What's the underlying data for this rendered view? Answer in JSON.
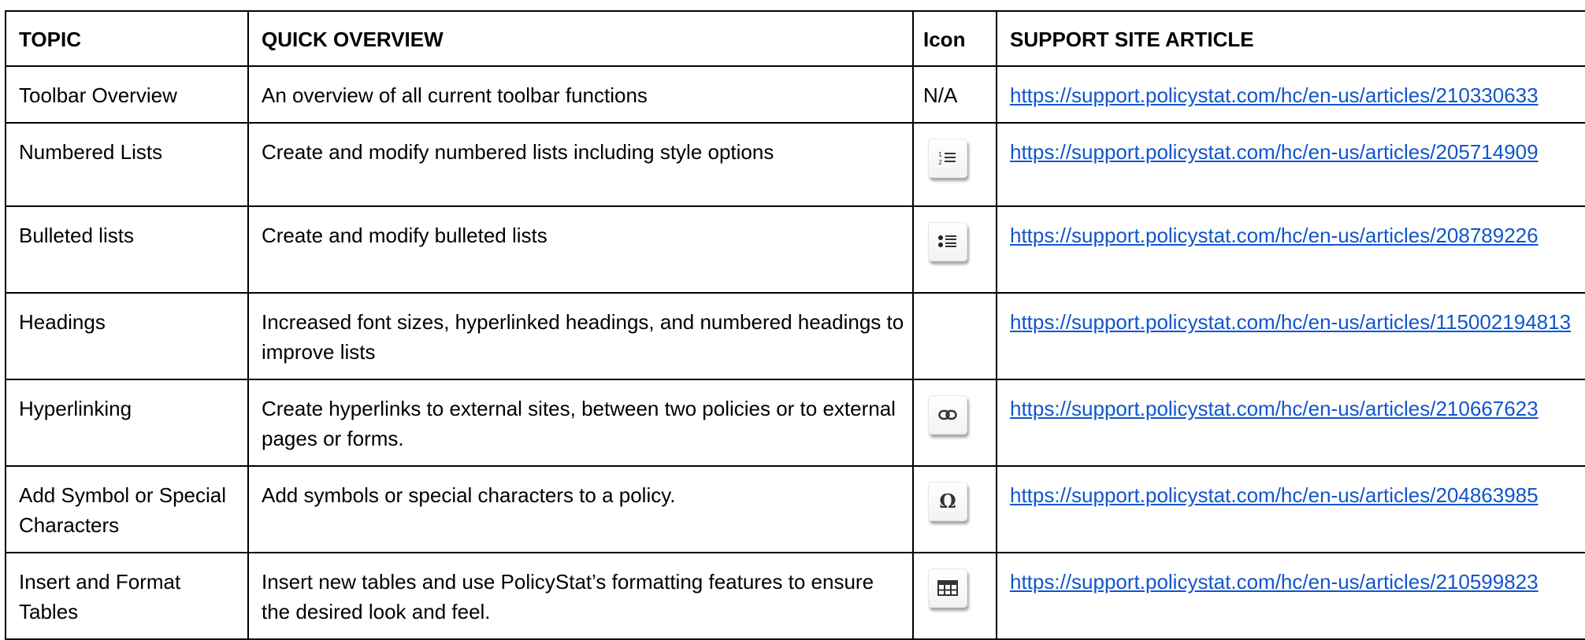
{
  "columns": {
    "topic": "TOPIC",
    "overview": "QUICK OVERVIEW",
    "icon": "Icon",
    "article": "SUPPORT SITE ARTICLE"
  },
  "rows": [
    {
      "topic": "Toolbar Overview",
      "overview": "An overview of all current toolbar functions",
      "icon_text": "N/A",
      "icon": "",
      "article": "https://support.policystat.com/hc/en-us/articles/210330633"
    },
    {
      "topic": "Numbered Lists",
      "overview": "Create and modify numbered lists including style options",
      "icon_text": "",
      "icon": "numbered-list-icon",
      "article": "https://support.policystat.com/hc/en-us/articles/205714909"
    },
    {
      "topic": "Bulleted lists",
      "overview": "Create and modify bulleted lists",
      "icon_text": "",
      "icon": "bulleted-list-icon",
      "article": "https://support.policystat.com/hc/en-us/articles/208789226"
    },
    {
      "topic": "Headings",
      "overview": "Increased font sizes, hyperlinked headings, and numbered headings to improve lists",
      "icon_text": "",
      "icon": "",
      "article": "https://support.policystat.com/hc/en-us/articles/115002194813"
    },
    {
      "topic": "Hyperlinking",
      "overview": "Create hyperlinks to external sites, between two policies or to external pages or forms.",
      "icon_text": "",
      "icon": "link-icon",
      "article": "https://support.policystat.com/hc/en-us/articles/210667623"
    },
    {
      "topic": "Add Symbol or Special Characters",
      "overview": "Add symbols or special characters to a policy.",
      "icon_text": "",
      "icon": "omega-symbol-icon",
      "article": "https://support.policystat.com/hc/en-us/articles/204863985"
    },
    {
      "topic": "Insert and Format Tables",
      "overview": "Insert new tables and use PolicyStat’s formatting features to ensure the desired look and feel.",
      "icon_text": "",
      "icon": "table-icon",
      "article": "https://support.policystat.com/hc/en-us/articles/210599823"
    }
  ],
  "colors": {
    "link": "#1155cc",
    "border": "#000000"
  }
}
